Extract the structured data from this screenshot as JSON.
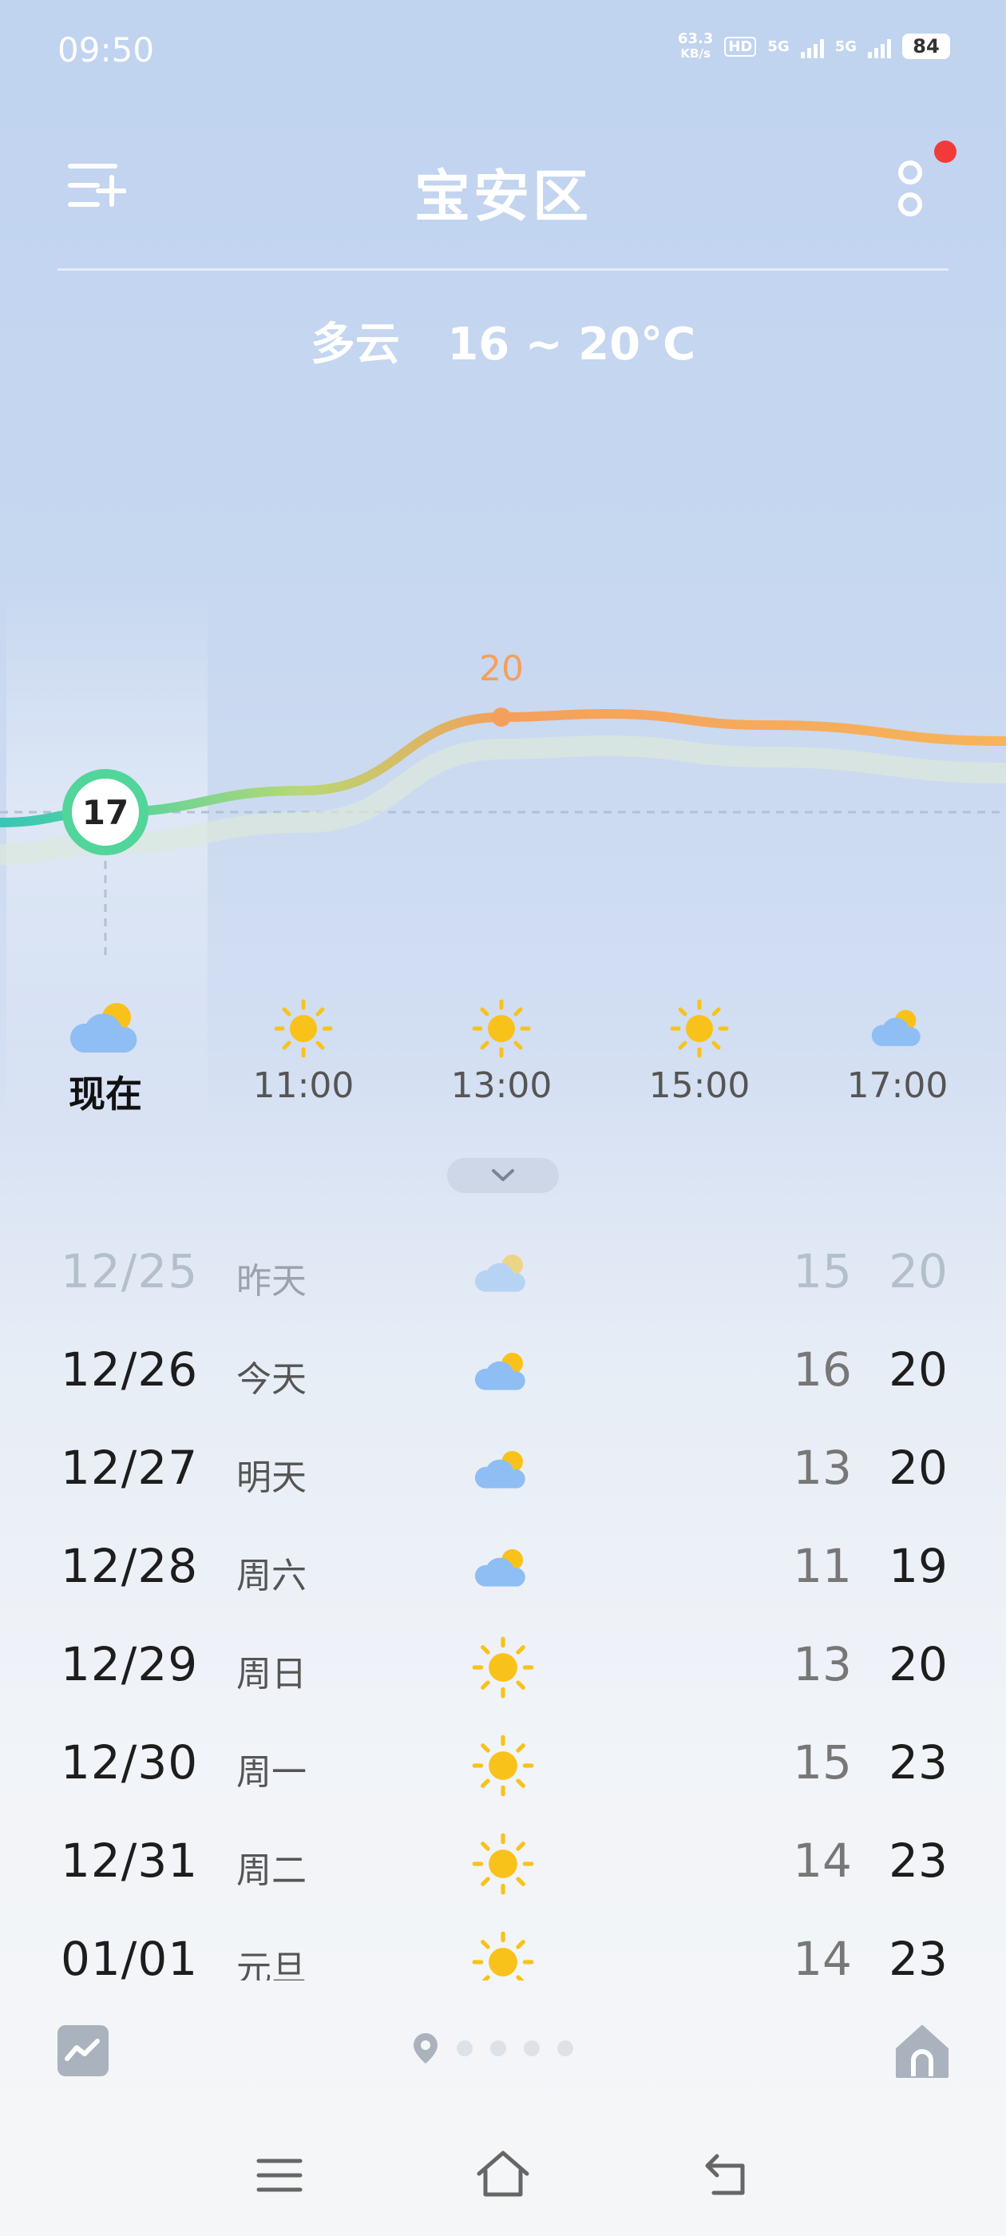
{
  "status_bar": {
    "time": "09:50",
    "net_speed_value": "63.3",
    "net_speed_unit": "KB/s",
    "hd_label": "HD",
    "signal1": "5G",
    "signal2": "5G",
    "battery": "84"
  },
  "header": {
    "title": "宝安区",
    "condition": "多云",
    "temp_range": "16 ~ 20°C"
  },
  "hourly": {
    "now_temp": "17",
    "peak_temp": "20",
    "temps": [
      15,
      17,
      18,
      20,
      20,
      19,
      19
    ],
    "items": [
      {
        "label": "现在",
        "icon": "cloudy-sun-icon"
      },
      {
        "label": "11:00",
        "icon": "sun-icon"
      },
      {
        "label": "13:00",
        "icon": "sun-icon"
      },
      {
        "label": "15:00",
        "icon": "sun-icon"
      },
      {
        "label": "17:00",
        "icon": "cloudy-sun-icon"
      }
    ]
  },
  "daily": [
    {
      "date": "12/25",
      "name": "昨天",
      "icon": "cloudy-sun-icon",
      "low": "15",
      "high": "20"
    },
    {
      "date": "12/26",
      "name": "今天",
      "icon": "cloudy-sun-icon",
      "low": "16",
      "high": "20"
    },
    {
      "date": "12/27",
      "name": "明天",
      "icon": "cloudy-sun-icon",
      "low": "13",
      "high": "20"
    },
    {
      "date": "12/28",
      "name": "周六",
      "icon": "cloudy-sun-icon",
      "low": "11",
      "high": "19"
    },
    {
      "date": "12/29",
      "name": "周日",
      "icon": "sun-icon",
      "low": "13",
      "high": "20"
    },
    {
      "date": "12/30",
      "name": "周一",
      "icon": "sun-icon",
      "low": "15",
      "high": "23"
    },
    {
      "date": "12/31",
      "name": "周二",
      "icon": "sun-icon",
      "low": "14",
      "high": "23"
    },
    {
      "date": "01/01",
      "name": "元旦",
      "icon": "sun-icon",
      "low": "14",
      "high": "23"
    }
  ],
  "pager": {
    "total_pages": 5,
    "current": 0
  }
}
